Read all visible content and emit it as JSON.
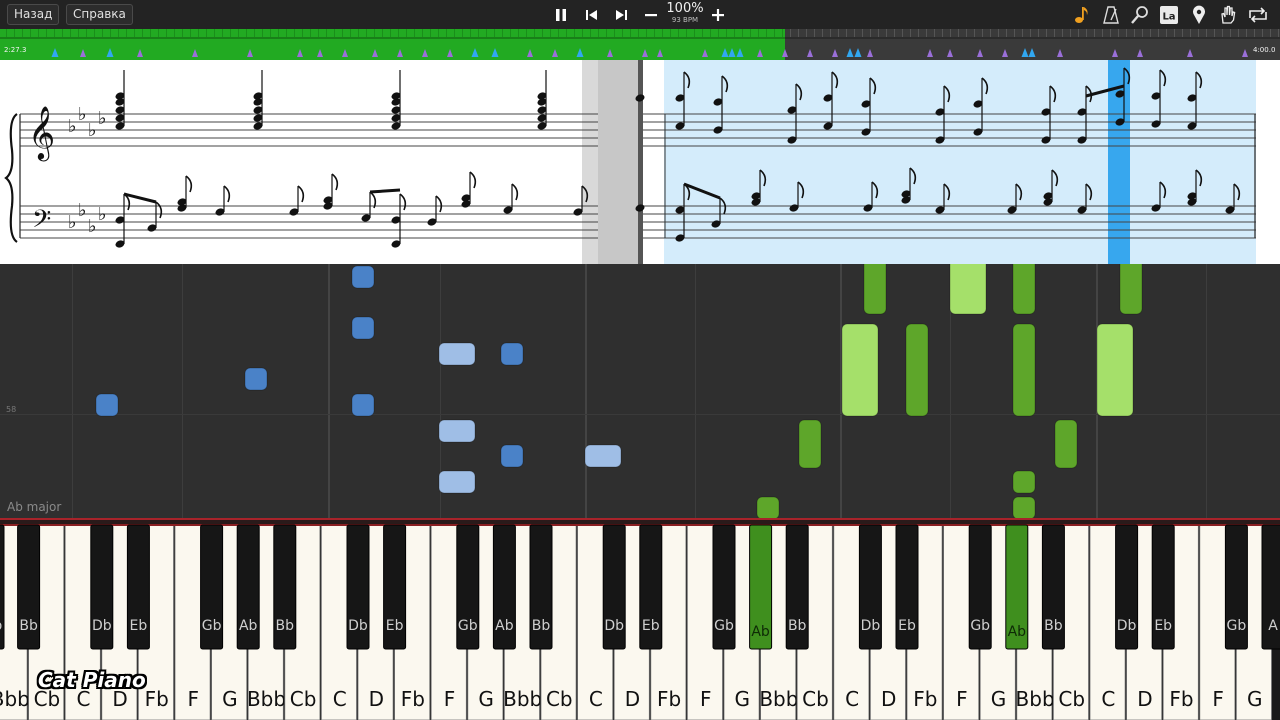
{
  "toolbar": {
    "back_label": "Назад",
    "help_label": "Справка",
    "zoom": "100%",
    "bpm": "93 BPM",
    "icons": [
      "pause-icon",
      "rewind-icon",
      "forward-icon",
      "minus-icon",
      "plus-icon",
      "note-icon",
      "metronome-icon",
      "search-icon",
      "label-icon",
      "location-icon",
      "hand-icon",
      "loop-icon"
    ],
    "label_icon_text": "La"
  },
  "timeline": {
    "current_time": "2:27.3",
    "end_time": "4:00.0",
    "progress": 0.613,
    "colors": {
      "progress": "#22aa22",
      "track": "#3a3a3a",
      "marker_blue": "#31a7f0",
      "marker_purple": "#9a6fd9"
    }
  },
  "piano_roll": {
    "key_signature": "Ab major",
    "pitch_marker": "58",
    "colors": {
      "left_hand": "#4a82c8",
      "left_hand_light": "#9fbee6",
      "right_hand": "#5ea62a",
      "right_hand_light": "#a5e06a"
    }
  },
  "keyboard": {
    "white_key_labels": [
      "Bbb",
      "Cb",
      "C",
      "D",
      "Fb",
      "F",
      "G",
      "Bbb",
      "Cb",
      "C",
      "D",
      "Fb",
      "F",
      "G",
      "Bbb",
      "Cb",
      "C",
      "D",
      "Fb",
      "F",
      "G",
      "Bbb",
      "Cb",
      "C",
      "D",
      "Fb",
      "F",
      "G",
      "Bbb",
      "Cb",
      "C",
      "D",
      "Fb",
      "F",
      "G"
    ],
    "black_key_labels": [
      "Bb",
      "Bb",
      "Db",
      "Eb",
      "Gb",
      "Ab",
      "Bb",
      "Db",
      "Eb",
      "Gb",
      "Ab",
      "Bb",
      "Db",
      "Eb",
      "Gb",
      "Ab",
      "Bb",
      "Db",
      "Eb",
      "Gb",
      "Ab",
      "Bb",
      "Db",
      "Eb",
      "Gb",
      "A"
    ],
    "pressed_keys": [
      "Ab",
      "Ab"
    ],
    "pressed_color": "#3f8f1e"
  },
  "watermark": "Cat Piano"
}
